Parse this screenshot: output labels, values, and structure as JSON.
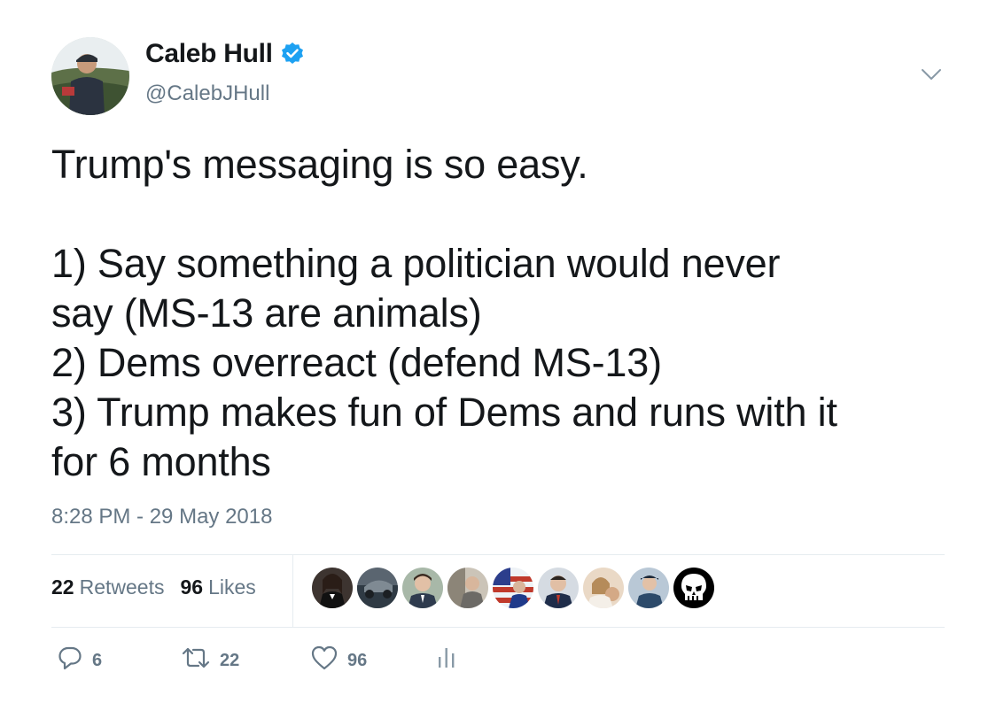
{
  "author": {
    "name": "Caleb Hull",
    "handle": "@CalebJHull",
    "verified": true
  },
  "tweet": {
    "lines": [
      "Trump's messaging is so easy.",
      "",
      "1) Say something a politician would never",
      "say (MS-13 are animals)",
      "2) Dems overreact (defend MS-13)",
      "3) Trump makes fun of Dems and runs with it",
      "for 6 months"
    ],
    "timestamp": "8:28 PM - 29 May 2018"
  },
  "stats": {
    "retweets_count": "22",
    "retweets_label": "Retweets",
    "likes_count": "96",
    "likes_label": "Likes"
  },
  "actions": {
    "reply_count": "6",
    "retweet_count": "22",
    "like_count": "96"
  },
  "colors": {
    "text": "#14171a",
    "secondary": "#657786",
    "verified": "#1da1f2",
    "divider": "#e6ecf0"
  },
  "icons": [
    "verified-badge-icon",
    "chevron-down-icon",
    "reply-icon",
    "retweet-icon",
    "heart-icon",
    "analytics-icon"
  ]
}
